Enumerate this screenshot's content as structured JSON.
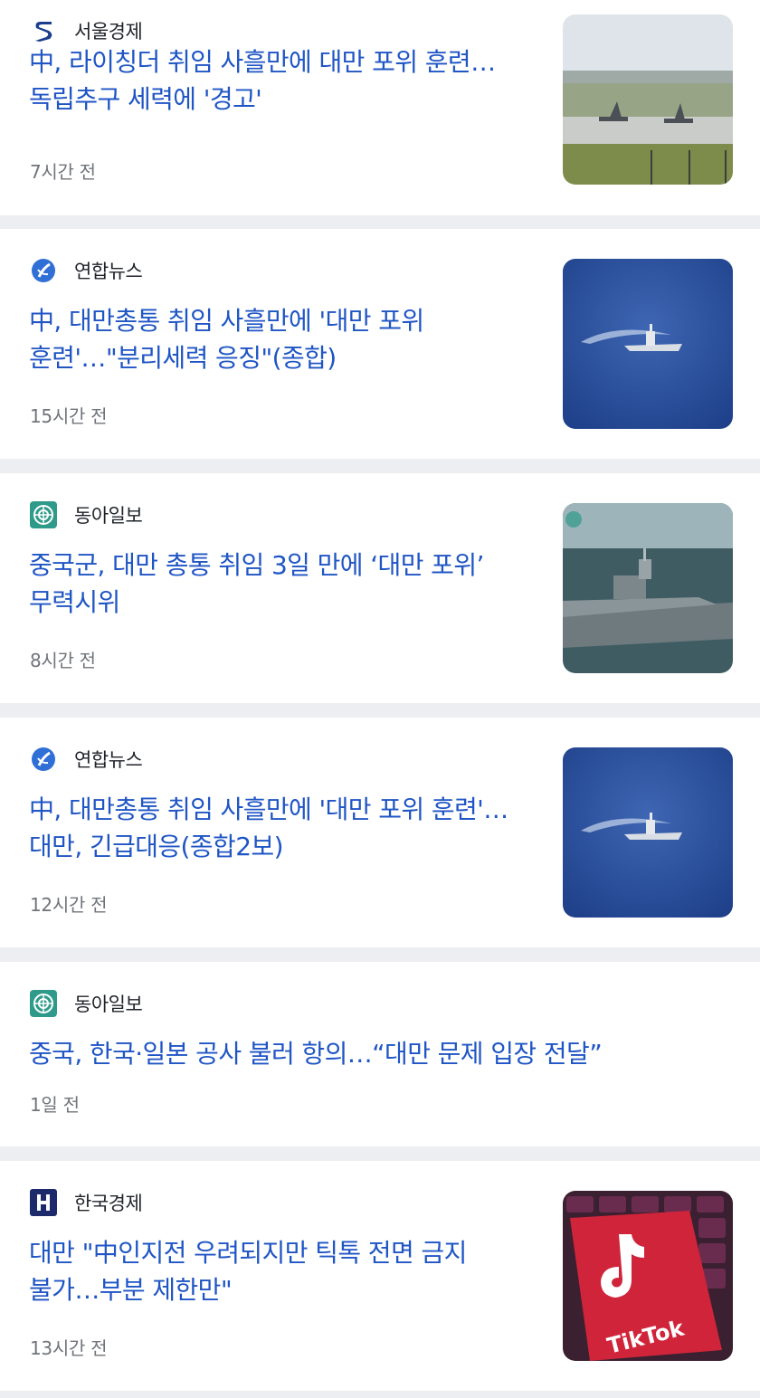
{
  "articles": [
    {
      "source": "서울경제",
      "logo": "seoul-economy-logo",
      "title": "中, 라이칭더 취임 사흘만에 대만 포위 훈련…독립추구 세력에 '경고'",
      "time": "7시간 전",
      "thumbnail": "fighter-jets-runway"
    },
    {
      "source": "연합뉴스",
      "logo": "yonhap-logo",
      "title": "中, 대만총통 취임 사흘만에 '대만 포위 훈련'…\"분리세력 응징\"(종합)",
      "time": "15시간 전",
      "thumbnail": "warship-at-sea"
    },
    {
      "source": "동아일보",
      "logo": "donga-logo",
      "title": "중국군, 대만 총통 취임 3일 만에 ‘대만 포위’ 무력시위",
      "time": "8시간 전",
      "thumbnail": "navy-frigate"
    },
    {
      "source": "연합뉴스",
      "logo": "yonhap-logo",
      "title": "中, 대만총통 취임 사흘만에 '대만 포위 훈련'…대만, 긴급대응(종합2보)",
      "time": "12시간 전",
      "thumbnail": "warship-at-sea"
    },
    {
      "source": "동아일보",
      "logo": "donga-logo",
      "title": "중국, 한국·일본 공사 불러 항의…“대만 문제 입장 전달”",
      "time": "1일 전"
    },
    {
      "source": "한국경제",
      "logo": "hankyung-logo",
      "title": "대만 \"中인지전 우려되지만 틱톡 전면 금지 불가…부분 제한만\"",
      "time": "13시간 전",
      "thumbnail": "tiktok-logo-keyboard",
      "thumbnail_text": "TikTok"
    }
  ]
}
